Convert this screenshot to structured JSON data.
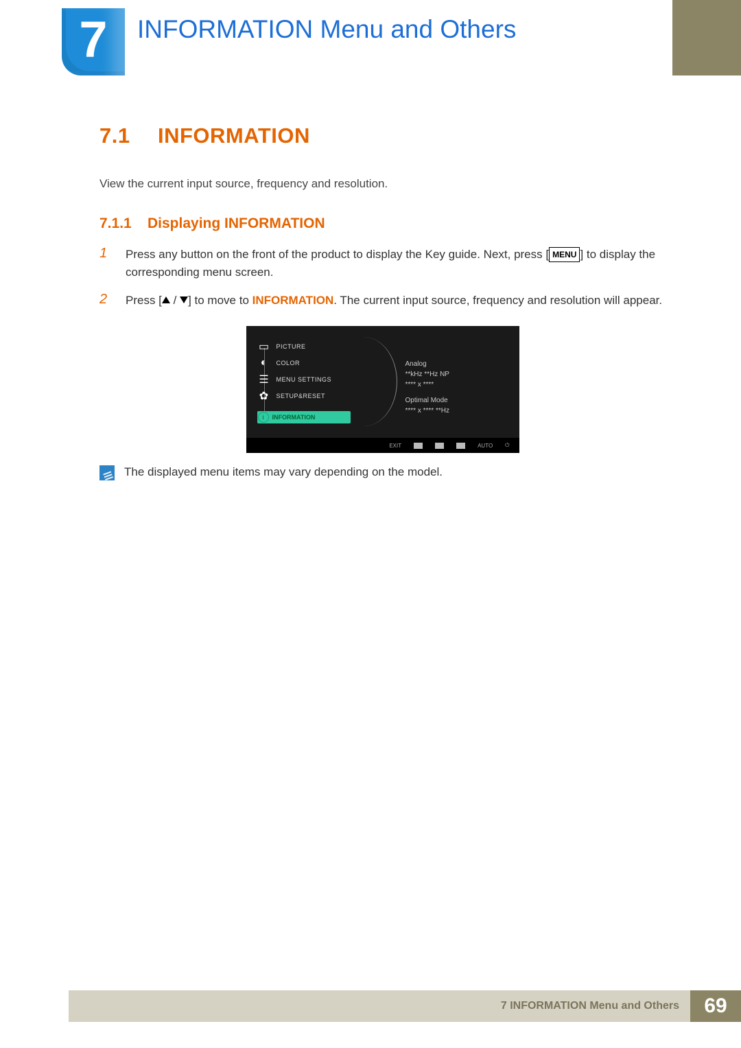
{
  "chapter": {
    "number": "7",
    "title": "INFORMATION Menu and Others"
  },
  "section": {
    "number": "7.1",
    "title": "INFORMATION",
    "intro": "View the current input source, frequency and resolution."
  },
  "subsection": {
    "number": "7.1.1",
    "title": "Displaying INFORMATION"
  },
  "steps": {
    "s1": {
      "num": "1",
      "pre": "Press any button on the front of the product to display the Key guide. Next, press [",
      "menu": "MENU",
      "post": "] to display the corresponding menu screen."
    },
    "s2": {
      "num": "2",
      "pre": "Press [",
      "sep": " / ",
      "mid": "] to move to ",
      "kw": "INFORMATION",
      "post": ". The current input source, frequency and resolution will appear."
    }
  },
  "osd": {
    "menu": {
      "picture": "PICTURE",
      "color": "COLOR",
      "settings": "MENU SETTINGS",
      "setup": "SETUP&RESET",
      "information": "INFORMATION"
    },
    "info": {
      "l1": "Analog",
      "l2": "**kHz  **Hz NP",
      "l3": "**** x ****",
      "l4": "Optimal Mode",
      "l5": "**** x ****  **Hz"
    },
    "ctrl": {
      "exit": "EXIT",
      "auto": "AUTO"
    }
  },
  "note": "The displayed menu items may vary depending on the model.",
  "footer": {
    "text": "7 INFORMATION Menu and Others",
    "page": "69"
  }
}
